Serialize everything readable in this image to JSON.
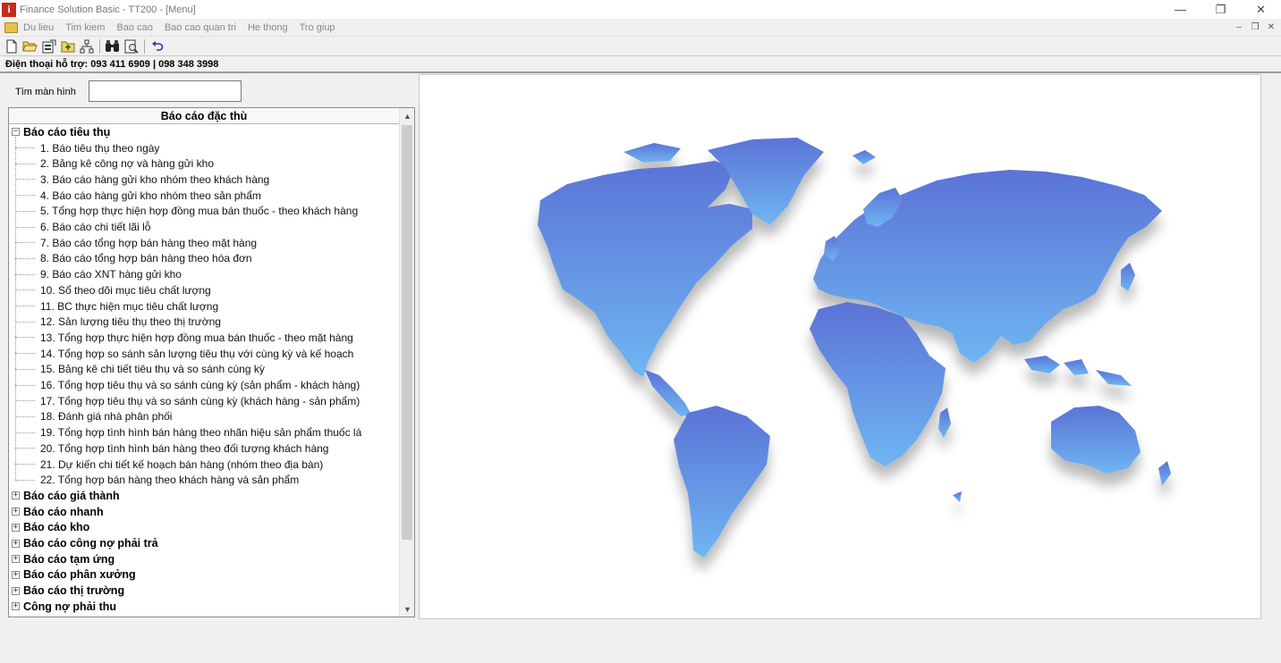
{
  "window": {
    "title": "Finance Solution Basic - TT200 - [Menu]",
    "app_icon_glyph": "i",
    "minimize": "—",
    "restore": "❐",
    "close": "✕"
  },
  "menubar": {
    "items": [
      "Du lieu",
      "Tim kiem",
      "Bao cao",
      "Bao cao quan tri",
      "He thong",
      "Tro giup"
    ],
    "mdi": {
      "minimize": "–",
      "restore": "❐",
      "close": "✕"
    }
  },
  "toolbar": {
    "icons": [
      "new-file-icon",
      "open-folder-icon",
      "properties-icon",
      "folder-up-icon",
      "tree-icon",
      "find-icon",
      "print-preview-icon",
      "undo-icon"
    ]
  },
  "support_phone": "Điện thoại hỗ trợ: 093 411 6909 | 098 348 3998",
  "search": {
    "label": "Tìm màn hình",
    "value": "",
    "placeholder": ""
  },
  "tree": {
    "header": "Báo cáo đặc thù",
    "expanded_group": {
      "label": "Báo cáo tiêu thụ",
      "expander": "−",
      "children": [
        "1. Báo tiêu thụ theo ngày",
        "2. Bảng kê công nợ và hàng gửi kho",
        "3. Báo cáo hàng gửi kho nhóm theo khách hàng",
        "4. Báo cáo hàng gửi kho nhóm theo sản phẩm",
        "5. Tổng hợp thực hiện hợp đồng mua bán thuốc - theo khách hàng",
        "6. Báo cáo chi tiết lãi lỗ",
        "7. Báo cáo tổng hợp bán hàng theo mặt hàng",
        "8. Báo cáo tổng hợp bán hàng theo hóa đơn",
        "9. Báo cáo XNT hàng gửi kho",
        "10. Sổ theo dõi mục tiêu chất lượng",
        "11. BC thực hiện mục tiêu chất lượng",
        "12. Sản lượng tiêu thụ theo thị trường",
        "13. Tổng hợp thực hiện hợp đồng mua bán thuốc - theo mặt hàng",
        "14. Tổng hợp so sánh sản lượng tiêu thụ với cùng kỳ và kế hoạch",
        "15. Bảng kê chi tiết tiêu thụ và so sánh cùng kỳ",
        "16. Tổng hợp tiêu thụ và so sánh cùng kỳ (sản phẩm - khách hàng)",
        "17. Tổng hợp tiêu thụ và so sánh cùng kỳ  (khách hàng - sản phẩm)",
        "18. Đánh giá nhà phân phối",
        "19. Tổng hợp tình hình bán hàng theo nhãn hiệu sản phẩm thuốc lá",
        "20. Tổng hợp tình hình bán hàng theo đối tượng khách hàng",
        "21. Dự kiến chi tiết kế hoạch bán hàng (nhóm theo địa bàn)",
        "22. Tổng hợp bán hàng theo khách hàng và sản phẩm"
      ]
    },
    "collapsed_expander": "+",
    "collapsed_groups": [
      "Báo cáo giá thành",
      "Báo cáo nhanh",
      "Báo cáo kho",
      "Báo cáo công nợ phải trả",
      "Báo cáo tạm ứng",
      "Báo cáo phân xưởng",
      "Báo cáo thị trường",
      "Công nợ phải thu"
    ],
    "scroll_up": "▲",
    "scroll_down": "▼"
  },
  "map": {
    "gradient_top": "#5b73d6",
    "gradient_bottom": "#6fb6f2"
  }
}
